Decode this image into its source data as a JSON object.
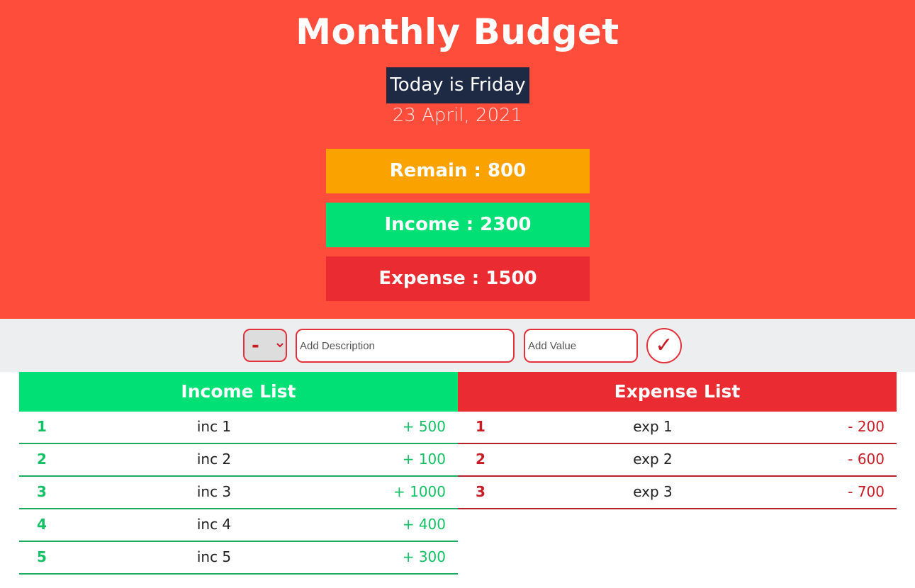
{
  "header": {
    "title": "Monthly Budget",
    "day_label": "Today is Friday",
    "date_label": "23 April, 2021",
    "remain_label": "Remain : 800",
    "income_label": "Income : 2300",
    "expense_label": "Expense : 1500"
  },
  "form": {
    "type_selected": "-",
    "description_placeholder": "Add Description",
    "value_placeholder": "Add Value",
    "submit_glyph": "✓"
  },
  "income_list": {
    "title": "Income List",
    "items": [
      {
        "num": "1",
        "desc": "inc 1",
        "amount": "+ 500"
      },
      {
        "num": "2",
        "desc": "inc 2",
        "amount": "+ 100"
      },
      {
        "num": "3",
        "desc": "inc 3",
        "amount": "+ 1000"
      },
      {
        "num": "4",
        "desc": "inc 4",
        "amount": "+ 400"
      },
      {
        "num": "5",
        "desc": "inc 5",
        "amount": "+ 300"
      }
    ]
  },
  "expense_list": {
    "title": "Expense List",
    "items": [
      {
        "num": "1",
        "desc": "exp 1",
        "amount": "- 200"
      },
      {
        "num": "2",
        "desc": "exp 2",
        "amount": "- 600"
      },
      {
        "num": "3",
        "desc": "exp 3",
        "amount": "- 700"
      }
    ]
  },
  "colors": {
    "header_bg": "#ff4d3b",
    "remain": "#f9a200",
    "income": "#00e074",
    "expense": "#ea2c32",
    "badge": "#1e2a44"
  }
}
